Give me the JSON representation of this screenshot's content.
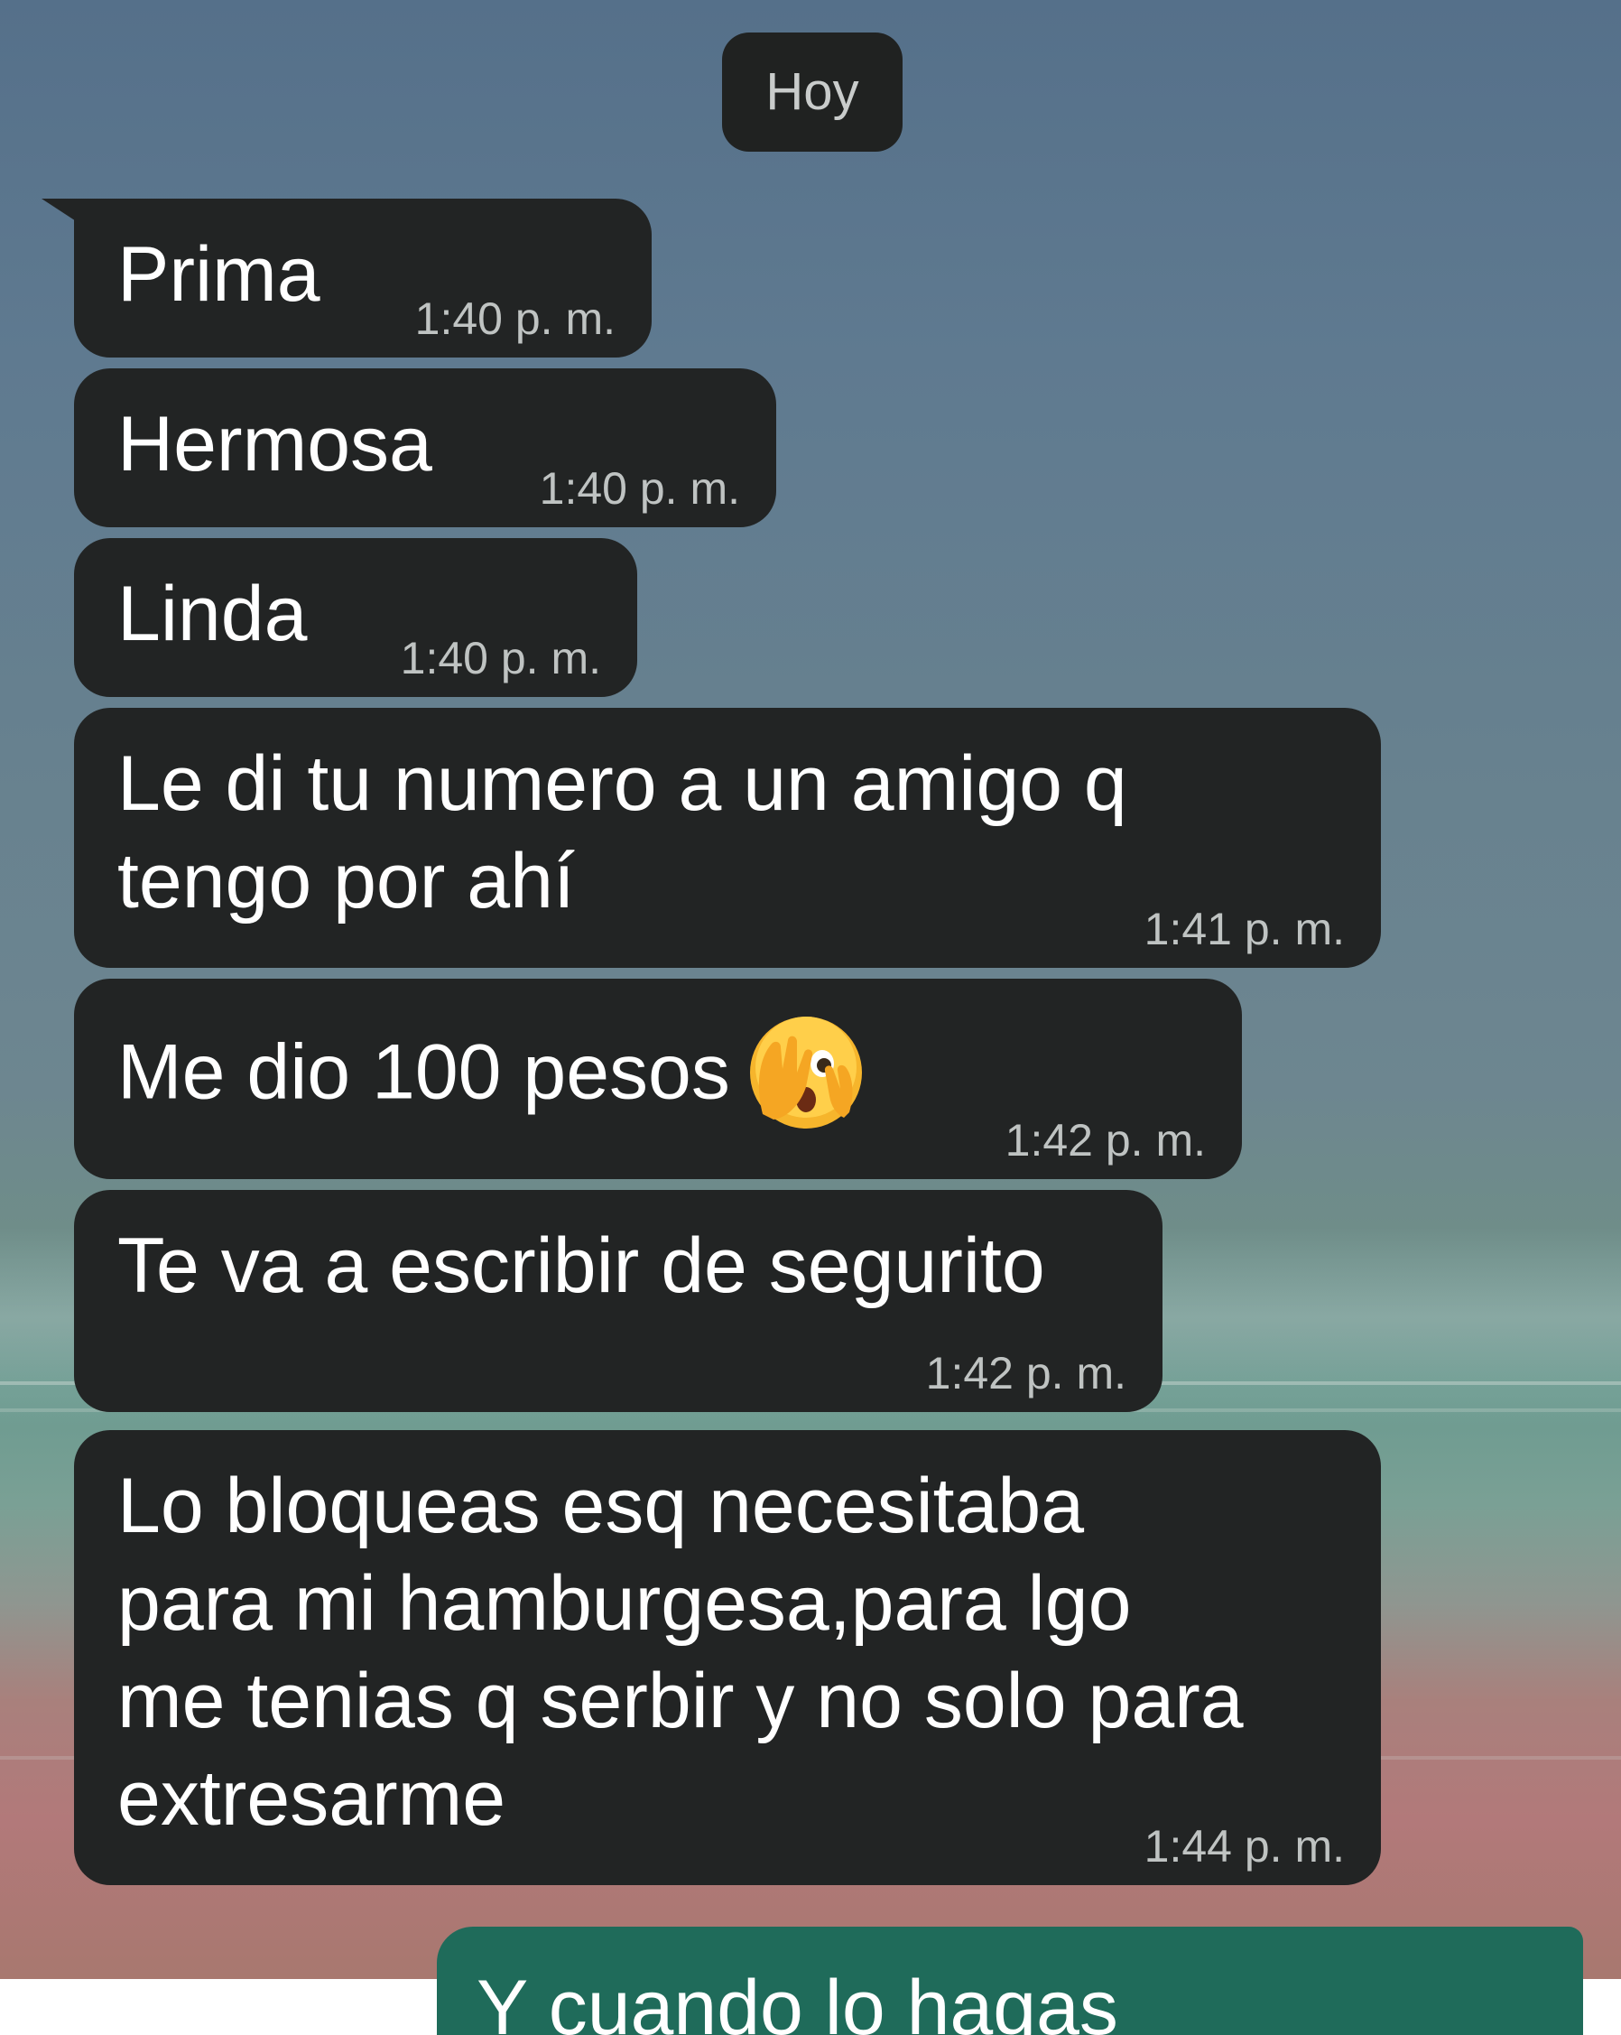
{
  "date_separator": "Hoy",
  "colors": {
    "incoming_bubble": "#222424",
    "outgoing_bubble": "#1f6b5a",
    "timestamp": "#bfc3c2",
    "date_chip": "#202221"
  },
  "messages": [
    {
      "text": "Prima",
      "time": "1:40 p. m."
    },
    {
      "text": "Hermosa",
      "time": "1:40 p. m."
    },
    {
      "text": "Linda",
      "time": "1:40 p. m."
    },
    {
      "text": "Le di tu numero a un amigo q\ntengo por ahí",
      "time": "1:41 p. m."
    },
    {
      "text": "Me dio 100 pesos",
      "emoji": "face-with-open-eyes-and-hand-over-mouth",
      "time": "1:42 p. m."
    },
    {
      "text": "Te va a escribir de segurito",
      "time": "1:42 p. m."
    },
    {
      "text": "Lo bloqueas esq necesitaba\npara mi hamburgesa,para lgo\nme tenias q serbir y no solo para\nextresarme",
      "time": "1:44 p. m."
    }
  ],
  "outgoing_partial": {
    "text": "Y cuando lo hagas"
  }
}
